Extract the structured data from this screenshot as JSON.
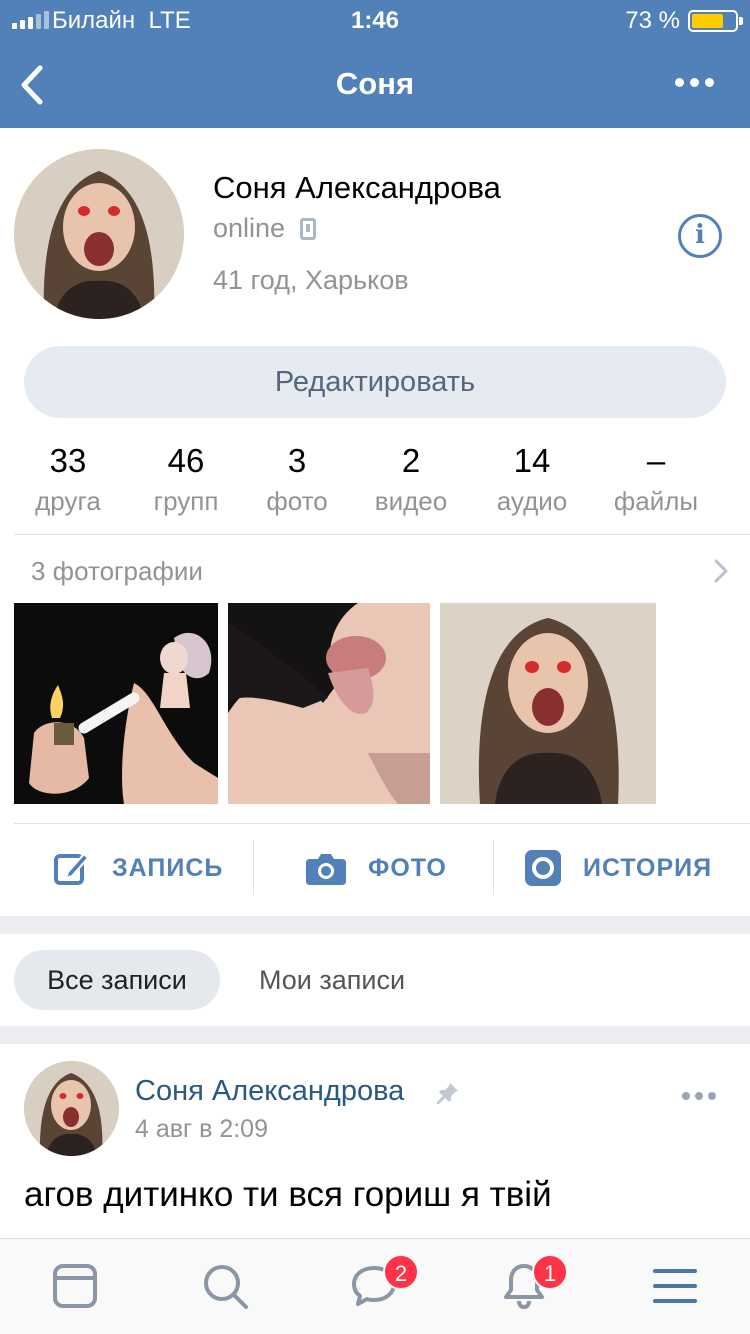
{
  "status_bar": {
    "carrier": "Билайн",
    "network": "LTE",
    "time": "1:46",
    "battery": "73 %",
    "battery_level": 0.73
  },
  "nav": {
    "title": "Соня",
    "back_icon": "chevron-left-icon",
    "more_icon": "more-horizontal-icon"
  },
  "profile": {
    "name": "Соня Александрова",
    "status": "online",
    "status_icon": "mobile-phone-icon",
    "info": "41 год, Харьков",
    "info_icon": "info-icon",
    "edit_button": "Редактировать"
  },
  "counters": [
    {
      "value": "33",
      "label": "друга"
    },
    {
      "value": "46",
      "label": "групп"
    },
    {
      "value": "3",
      "label": "фото"
    },
    {
      "value": "2",
      "label": "видео"
    },
    {
      "value": "14",
      "label": "аудио"
    },
    {
      "value": "–",
      "label": "файлы"
    }
  ],
  "photos": {
    "title": "3 фотографии",
    "chevron_icon": "chevron-right-icon"
  },
  "actions": [
    {
      "label": "ЗАПИСЬ",
      "icon": "edit-icon"
    },
    {
      "label": "ФОТО",
      "icon": "camera-icon"
    },
    {
      "label": "ИСТОРИЯ",
      "icon": "story-icon"
    }
  ],
  "feed_tabs": {
    "all": "Все записи",
    "mine": "Мои записи"
  },
  "post": {
    "author": "Соня Александрова",
    "pin_icon": "pin-icon",
    "date": "4 авг в 2:09",
    "text": "агов дитинко ти вся гориш я твій"
  },
  "tabbar": {
    "items": [
      "news-icon",
      "search-icon",
      "messages-icon",
      "notifications-icon",
      "menu-icon"
    ],
    "messages_badge": "2",
    "notifications_badge": "1"
  },
  "colors": {
    "brand": "#5181b8",
    "badge": "#ff3347",
    "battery": "#ffcc00"
  }
}
